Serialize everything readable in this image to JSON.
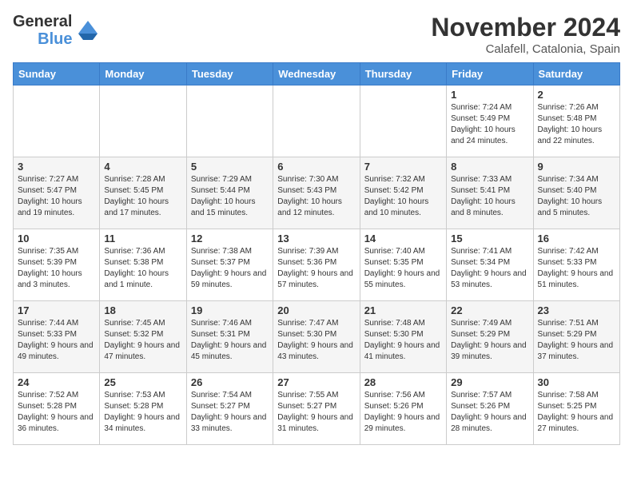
{
  "header": {
    "logo_line1": "General",
    "logo_line2": "Blue",
    "month": "November 2024",
    "location": "Calafell, Catalonia, Spain"
  },
  "days_of_week": [
    "Sunday",
    "Monday",
    "Tuesday",
    "Wednesday",
    "Thursday",
    "Friday",
    "Saturday"
  ],
  "weeks": [
    [
      {
        "day": "",
        "info": ""
      },
      {
        "day": "",
        "info": ""
      },
      {
        "day": "",
        "info": ""
      },
      {
        "day": "",
        "info": ""
      },
      {
        "day": "",
        "info": ""
      },
      {
        "day": "1",
        "info": "Sunrise: 7:24 AM\nSunset: 5:49 PM\nDaylight: 10 hours and 24 minutes."
      },
      {
        "day": "2",
        "info": "Sunrise: 7:26 AM\nSunset: 5:48 PM\nDaylight: 10 hours and 22 minutes."
      }
    ],
    [
      {
        "day": "3",
        "info": "Sunrise: 7:27 AM\nSunset: 5:47 PM\nDaylight: 10 hours and 19 minutes."
      },
      {
        "day": "4",
        "info": "Sunrise: 7:28 AM\nSunset: 5:45 PM\nDaylight: 10 hours and 17 minutes."
      },
      {
        "day": "5",
        "info": "Sunrise: 7:29 AM\nSunset: 5:44 PM\nDaylight: 10 hours and 15 minutes."
      },
      {
        "day": "6",
        "info": "Sunrise: 7:30 AM\nSunset: 5:43 PM\nDaylight: 10 hours and 12 minutes."
      },
      {
        "day": "7",
        "info": "Sunrise: 7:32 AM\nSunset: 5:42 PM\nDaylight: 10 hours and 10 minutes."
      },
      {
        "day": "8",
        "info": "Sunrise: 7:33 AM\nSunset: 5:41 PM\nDaylight: 10 hours and 8 minutes."
      },
      {
        "day": "9",
        "info": "Sunrise: 7:34 AM\nSunset: 5:40 PM\nDaylight: 10 hours and 5 minutes."
      }
    ],
    [
      {
        "day": "10",
        "info": "Sunrise: 7:35 AM\nSunset: 5:39 PM\nDaylight: 10 hours and 3 minutes."
      },
      {
        "day": "11",
        "info": "Sunrise: 7:36 AM\nSunset: 5:38 PM\nDaylight: 10 hours and 1 minute."
      },
      {
        "day": "12",
        "info": "Sunrise: 7:38 AM\nSunset: 5:37 PM\nDaylight: 9 hours and 59 minutes."
      },
      {
        "day": "13",
        "info": "Sunrise: 7:39 AM\nSunset: 5:36 PM\nDaylight: 9 hours and 57 minutes."
      },
      {
        "day": "14",
        "info": "Sunrise: 7:40 AM\nSunset: 5:35 PM\nDaylight: 9 hours and 55 minutes."
      },
      {
        "day": "15",
        "info": "Sunrise: 7:41 AM\nSunset: 5:34 PM\nDaylight: 9 hours and 53 minutes."
      },
      {
        "day": "16",
        "info": "Sunrise: 7:42 AM\nSunset: 5:33 PM\nDaylight: 9 hours and 51 minutes."
      }
    ],
    [
      {
        "day": "17",
        "info": "Sunrise: 7:44 AM\nSunset: 5:33 PM\nDaylight: 9 hours and 49 minutes."
      },
      {
        "day": "18",
        "info": "Sunrise: 7:45 AM\nSunset: 5:32 PM\nDaylight: 9 hours and 47 minutes."
      },
      {
        "day": "19",
        "info": "Sunrise: 7:46 AM\nSunset: 5:31 PM\nDaylight: 9 hours and 45 minutes."
      },
      {
        "day": "20",
        "info": "Sunrise: 7:47 AM\nSunset: 5:30 PM\nDaylight: 9 hours and 43 minutes."
      },
      {
        "day": "21",
        "info": "Sunrise: 7:48 AM\nSunset: 5:30 PM\nDaylight: 9 hours and 41 minutes."
      },
      {
        "day": "22",
        "info": "Sunrise: 7:49 AM\nSunset: 5:29 PM\nDaylight: 9 hours and 39 minutes."
      },
      {
        "day": "23",
        "info": "Sunrise: 7:51 AM\nSunset: 5:29 PM\nDaylight: 9 hours and 37 minutes."
      }
    ],
    [
      {
        "day": "24",
        "info": "Sunrise: 7:52 AM\nSunset: 5:28 PM\nDaylight: 9 hours and 36 minutes."
      },
      {
        "day": "25",
        "info": "Sunrise: 7:53 AM\nSunset: 5:28 PM\nDaylight: 9 hours and 34 minutes."
      },
      {
        "day": "26",
        "info": "Sunrise: 7:54 AM\nSunset: 5:27 PM\nDaylight: 9 hours and 33 minutes."
      },
      {
        "day": "27",
        "info": "Sunrise: 7:55 AM\nSunset: 5:27 PM\nDaylight: 9 hours and 31 minutes."
      },
      {
        "day": "28",
        "info": "Sunrise: 7:56 AM\nSunset: 5:26 PM\nDaylight: 9 hours and 29 minutes."
      },
      {
        "day": "29",
        "info": "Sunrise: 7:57 AM\nSunset: 5:26 PM\nDaylight: 9 hours and 28 minutes."
      },
      {
        "day": "30",
        "info": "Sunrise: 7:58 AM\nSunset: 5:25 PM\nDaylight: 9 hours and 27 minutes."
      }
    ]
  ]
}
